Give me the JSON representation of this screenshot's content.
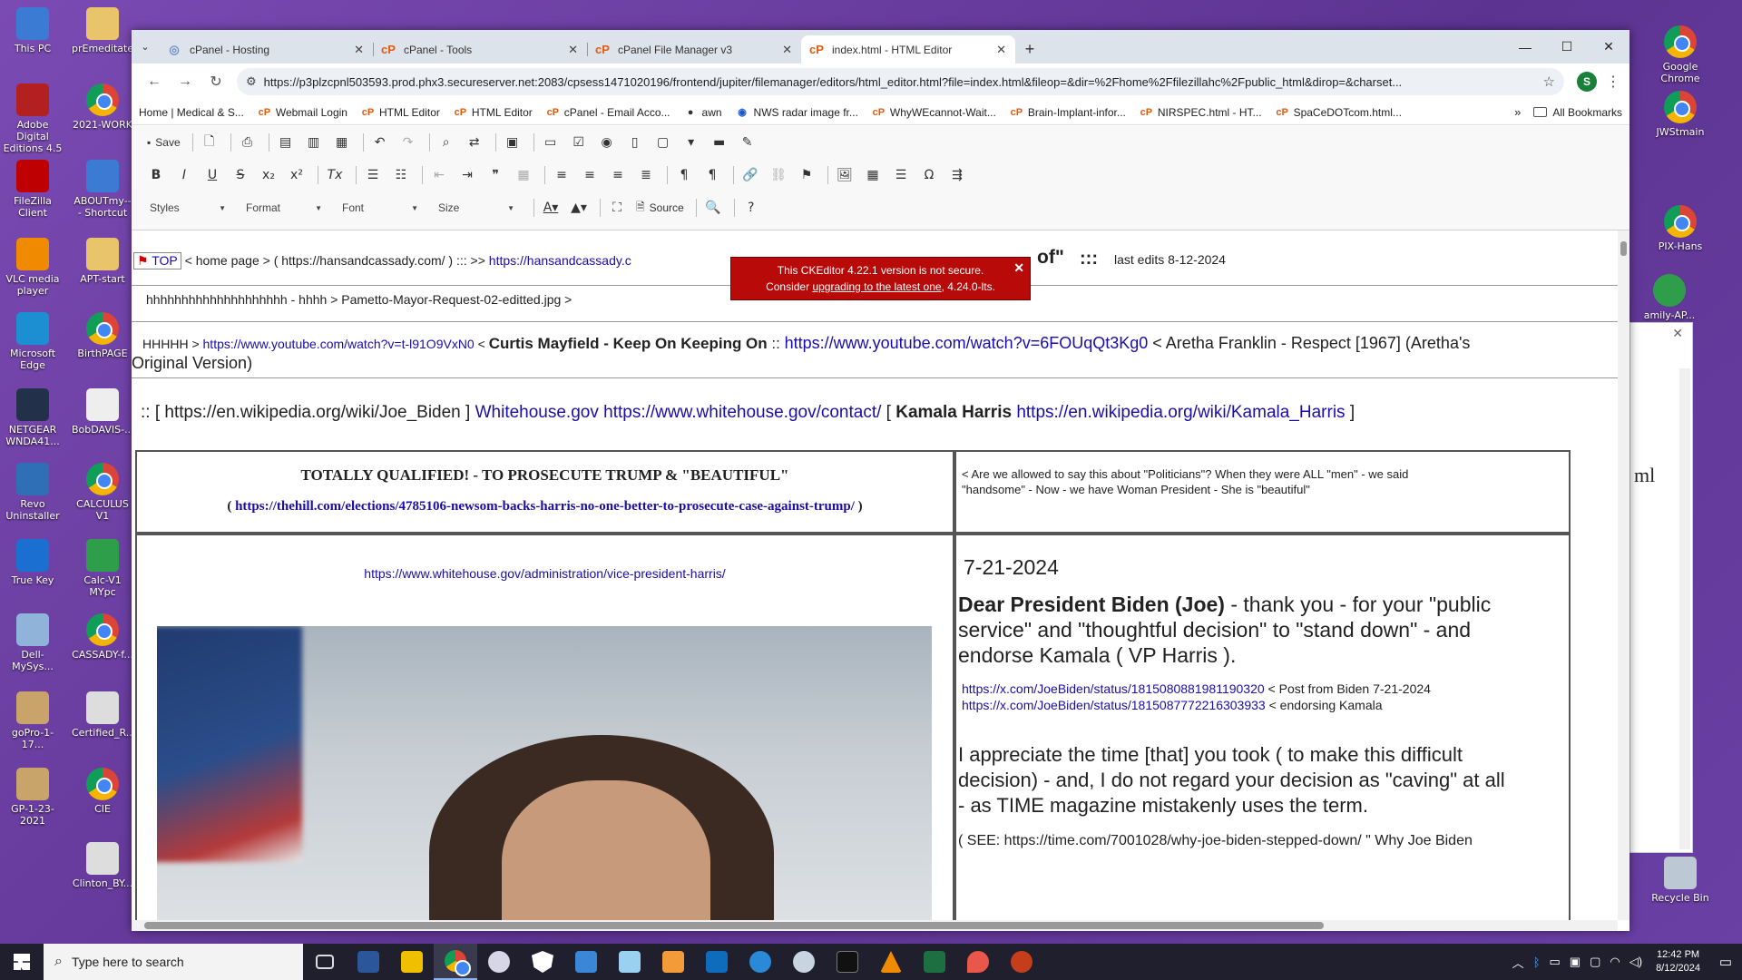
{
  "desktop_icons": [
    {
      "label": "This PC",
      "color": "#3b7bd4"
    },
    {
      "label": "prEmeditate",
      "color": "#e9c46a"
    },
    {
      "label": "Adobe Digital Editions 4.5",
      "color": "#b32020"
    },
    {
      "label": "2021-WORK",
      "color": "chrome"
    },
    {
      "label": "FileZilla Client",
      "color": "#bf0000"
    },
    {
      "label": "ABOUTmy-- - Shortcut",
      "color": "#3b7bd4"
    },
    {
      "label": "VLC media player",
      "color": "#f08a00"
    },
    {
      "label": "APT-start",
      "color": "#e9c46a"
    },
    {
      "label": "Microsoft Edge",
      "color": "#1b8fd1"
    },
    {
      "label": "BirthPAGE",
      "color": "chrome"
    },
    {
      "label": "NETGEAR WNDA41...",
      "color": "#22304a"
    },
    {
      "label": "BobDAVIS-...",
      "color": "#eeeeee"
    },
    {
      "label": "Revo Uninstaller",
      "color": "#2e6fb5"
    },
    {
      "label": "CALCULUS V1",
      "color": "chrome"
    },
    {
      "label": "True Key",
      "color": "#1a6fd1"
    },
    {
      "label": "Calc-V1 MYpc",
      "color": "#2e9e4b"
    },
    {
      "label": "Dell-MySys...",
      "color": "#8fb3d9"
    },
    {
      "label": "CASSADY-f...",
      "color": "chrome"
    },
    {
      "label": "goPro-1-17...",
      "color": "#c9a46a"
    },
    {
      "label": "Certified_R...",
      "color": "#dddddd"
    },
    {
      "label": "GP-1-23-2021",
      "color": "#c9a46a"
    },
    {
      "label": "CIE",
      "color": "chrome"
    },
    {
      "label": "Clinton_BY...",
      "color": "#dddddd"
    }
  ],
  "right_icons": [
    {
      "label": "Google Chrome"
    },
    {
      "label": "JWStmain"
    },
    {
      "label": "PIX-Hans"
    },
    {
      "label": "amily-AP..."
    },
    {
      "label": "Recycle Bin"
    }
  ],
  "side_window": {
    "text": "ml",
    "close": "✕"
  },
  "tabs": [
    {
      "title": "cPanel - Hosting",
      "active": false
    },
    {
      "title": "cPanel - Tools",
      "active": false
    },
    {
      "title": "cPanel File Manager v3",
      "active": false
    },
    {
      "title": "index.html - HTML Editor",
      "active": true
    }
  ],
  "window_controls": {
    "minimize": "—",
    "maximize": "☐",
    "close": "✕"
  },
  "address": {
    "url": "https://p3plzcpnl503593.prod.phx3.secureserver.net:2083/cpsess1471020196/frontend/jupiter/filemanager/editors/html_editor.html?file=index.html&fileop=&dir=%2Fhome%2Ffilezillahc%2Fpublic_html&dirop=&charset...",
    "avatar": "S"
  },
  "bookmarks": [
    {
      "label": "Home | Medical & S..."
    },
    {
      "label": "Webmail Login"
    },
    {
      "label": "HTML Editor"
    },
    {
      "label": "HTML Editor"
    },
    {
      "label": "cPanel - Email Acco..."
    },
    {
      "label": "awn"
    },
    {
      "label": "NWS radar image fr..."
    },
    {
      "label": "WhyWEcannot-Wait..."
    },
    {
      "label": "Brain-Implant-infor..."
    },
    {
      "label": "NIRSPEC.html - HT..."
    },
    {
      "label": "SpaCeDOTcom.html..."
    }
  ],
  "bookmarks_more": "»",
  "all_bookmarks": "All Bookmarks",
  "toolbar": {
    "save": "Save",
    "source": "Source",
    "combos": [
      "Styles",
      "Format",
      "Font",
      "Size"
    ],
    "help": "?"
  },
  "notice": {
    "line1": "This CKEditor 4.22.1 version is not secure.",
    "line2a": "Consider ",
    "link": "upgrading to the latest one",
    "line2b": ", 4.24.0-lts."
  },
  "content": {
    "top_flag": "TOP",
    "line1_a": " < home page >  (  https://hansandcassady.com/  )     :::      >>  ",
    "line1_link": "https://hansandcassady.c",
    "line1_of": "of\"",
    "line1_sep": ":::",
    "line1_edits": "last edits 8-12-2024",
    "line2": "hhhhhhhhhhhhhhhhhhhh -  hhhh > Pametto-Mayor-Request-02-editted.jpg >",
    "line3_a": "HHHHH > ",
    "line3_link1": "https://www.youtube.com/watch?v=t-l91O9VxN0",
    "line3_b": " < ",
    "line3_bold": "Curtis Mayfield - Keep On Keeping On",
    "line3_c": "  ::  ",
    "line3_link2": "https://www.youtube.com/watch?v=6FOUqQt3Kg0",
    "line3_d": " < Aretha Franklin - Respect [1967] (Aretha's",
    "line3_e": "Original Version)",
    "line4_a": "::  [  https://en.wikipedia.org/wiki/Joe_Biden  ]   ",
    "line4_link1": "Whitehouse.gov",
    "line4_b": "   ",
    "line4_link2": "https://www.whitehouse.gov/contact/",
    "line4_c": "   [ ",
    "line4_bold": "Kamala Harris",
    "line4_d": " ",
    "line4_link3": "https://en.wikipedia.org/wiki/Kamala_Harris",
    "line4_e": " ]",
    "cell1_title": "TOTALLY QUALIFIED! - TO PROSECUTE TRUMP  &  \"BEAUTIFUL\"",
    "cell1_link_open": "( ",
    "cell1_link": "https://thehill.com/elections/4785106-newsom-backs-harris-no-one-better-to-prosecute-case-against-trump/",
    "cell1_link_close": " )",
    "cell2_text1": "< Are we allowed to say this about \"Politicians\"?  When they were ALL \"men\" - we said",
    "cell2_text2": "\"handsome\"  - Now - we have Woman President - She is \"beautiful\"",
    "cell3_link": "https://www.whitehouse.gov/administration/vice-president-harris/",
    "date": "7-21-2024",
    "dear_bold": "Dear President Biden (Joe)",
    "dear_rest": "  - thank you - for your \"public",
    "dear_2": "service\" and \"thoughtful decision\" to \"stand down\" - and",
    "dear_3": "endorse Kamala ( VP Harris ).",
    "x_link1": "https://x.com/JoeBiden/status/1815080881981190320",
    "x_text1": " < Post from Biden 7-21-2024",
    "x_link2": "https://x.com/JoeBiden/status/1815087772216303933",
    "x_text2": " < endorsing Kamala",
    "appr_1": " I appreciate the time [that] you took ( to make this difficult",
    "appr_2": "decision) - and, I do not regard your decision as \"caving\" at all",
    "appr_3": "- as TIME magazine mistakenly uses the term.",
    "see_line": "( SEE: https://time.com/7001028/why-joe-biden-stepped-down/ \" Why Joe Biden"
  },
  "taskbar": {
    "search_placeholder": "Type here to search",
    "time": "12:42 PM",
    "date": "8/12/2024"
  }
}
